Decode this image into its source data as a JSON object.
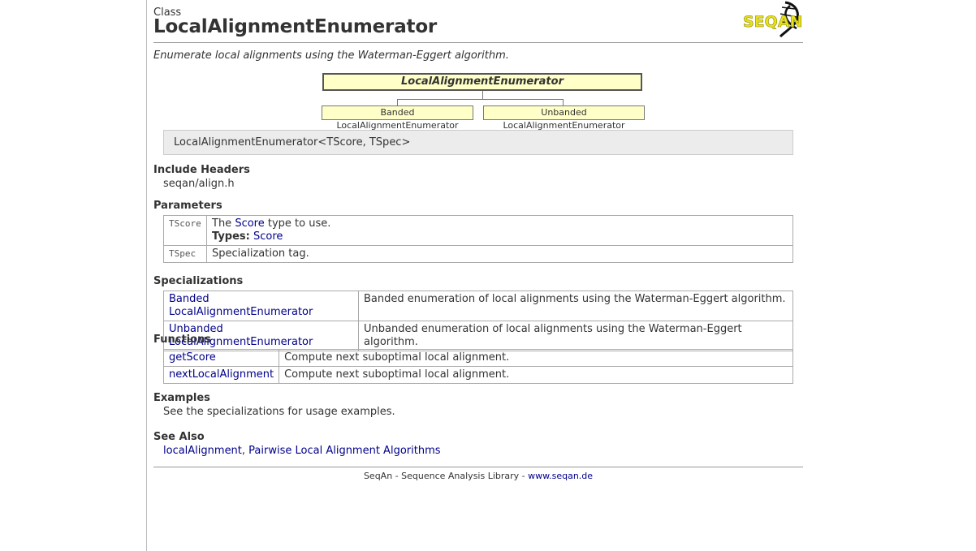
{
  "header": {
    "kind": "Class",
    "title": "LocalAlignmentEnumerator",
    "logo_text": "SEQAN"
  },
  "summary": "Enumerate local alignments using the Waterman-Eggert algorithm.",
  "diagram": {
    "main": "LocalAlignmentEnumerator",
    "children": [
      "Banded LocalAlignmentEnumerator",
      "Unbanded LocalAlignmentEnumerator"
    ]
  },
  "signature": "LocalAlignmentEnumerator<TScore, TSpec>",
  "include": {
    "heading": "Include Headers",
    "value": "seqan/align.h"
  },
  "parameters": {
    "heading": "Parameters",
    "tscore_name": "TScore",
    "tscore_pre": "The ",
    "tscore_link": "Score",
    "tscore_post": " type to use.",
    "types_label": "Types:",
    "types_link": "Score",
    "tspec_name": "TSpec",
    "tspec_desc": "Specialization tag."
  },
  "specializations": {
    "heading": "Specializations",
    "rows": [
      {
        "name": "Banded LocalAlignmentEnumerator",
        "desc": "Banded enumeration of local alignments using the Waterman-Eggert algorithm."
      },
      {
        "name": "Unbanded LocalAlignmentEnumerator",
        "desc": "Unbanded enumeration of local alignments using the Waterman-Eggert algorithm."
      }
    ]
  },
  "functions": {
    "heading": "Functions",
    "rows": [
      {
        "name": "getScore",
        "desc": "Compute next suboptimal local alignment."
      },
      {
        "name": "nextLocalAlignment",
        "desc": "Compute next suboptimal local alignment."
      }
    ]
  },
  "examples": {
    "heading": "Examples",
    "text": "See the specializations for usage examples."
  },
  "see_also": {
    "heading": "See Also",
    "link1": "localAlignment",
    "sep": ", ",
    "link2": "Pairwise Local Alignment Algorithms"
  },
  "footer": {
    "text": "SeqAn - Sequence Analysis Library - ",
    "link": "www.seqan.de"
  },
  "colors": {
    "link": "#00008b",
    "diagram_fill": "#ffffc8",
    "logo_yellow": "#e8e21a"
  }
}
